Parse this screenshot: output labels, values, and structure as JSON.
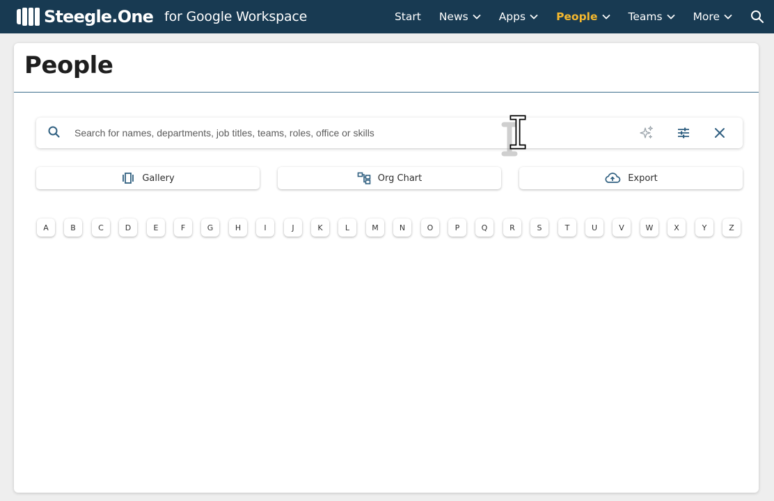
{
  "header": {
    "brand_name": "Steegle.One",
    "brand_sub": "for Google Workspace",
    "nav": [
      {
        "label": "Start",
        "has_menu": false
      },
      {
        "label": "News",
        "has_menu": true
      },
      {
        "label": "Apps",
        "has_menu": true
      },
      {
        "label": "People",
        "has_menu": true,
        "active": true
      },
      {
        "label": "Teams",
        "has_menu": true
      },
      {
        "label": "More",
        "has_menu": true
      }
    ],
    "search_icon": "search-icon"
  },
  "page": {
    "title": "People",
    "search": {
      "placeholder": "Search for names, departments, job titles, teams, roles, office or skills",
      "value": ""
    },
    "views": [
      {
        "label": "Gallery",
        "icon": "gallery-icon"
      },
      {
        "label": "Org Chart",
        "icon": "org-chart-icon"
      },
      {
        "label": "Export",
        "icon": "cloud-upload-icon"
      }
    ],
    "letters": [
      "A",
      "B",
      "C",
      "D",
      "E",
      "F",
      "G",
      "H",
      "I",
      "J",
      "K",
      "L",
      "M",
      "N",
      "O",
      "P",
      "Q",
      "R",
      "S",
      "T",
      "U",
      "V",
      "W",
      "X",
      "Y",
      "Z"
    ]
  },
  "colors": {
    "header_bg": "#183a52",
    "active_nav": "#f5b82e",
    "icon_blue": "#2f5f80"
  }
}
